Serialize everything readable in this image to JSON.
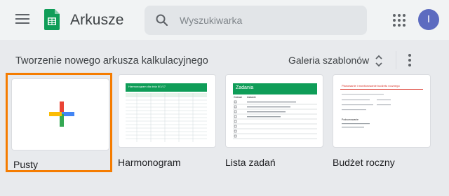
{
  "header": {
    "app_title": "Arkusze",
    "search_placeholder": "Wyszukiwarka",
    "avatar_initial": "I",
    "icons": {
      "menu": "menu-icon",
      "logo": "sheets-logo",
      "search": "search-icon",
      "apps": "apps-grid-icon"
    }
  },
  "section": {
    "title": "Tworzenie nowego arkusza kalkulacyjnego",
    "gallery_label": "Galeria szablonów",
    "icons": {
      "unfold": "unfold-more-icon",
      "more": "more-vert-icon"
    }
  },
  "templates": [
    {
      "label": "Pusty",
      "selected": true
    },
    {
      "label": "Harmonogram",
      "thumb_title": "Harmonogram dla dnia 6/1/17"
    },
    {
      "label": "Lista zadań",
      "thumb_title": "Zadania",
      "thumb_col_done": "Gotowe",
      "thumb_col_task": "Zadanie"
    },
    {
      "label": "Budżet roczny",
      "thumb_title": "Planowanie i monitorowanie budżetu rocznego",
      "thumb_subtitle": "Podsumowanie"
    }
  ],
  "colors": {
    "accent_selected": "#f57c00",
    "sheets_green": "#0f9d58",
    "budget_red": "#d93025"
  }
}
